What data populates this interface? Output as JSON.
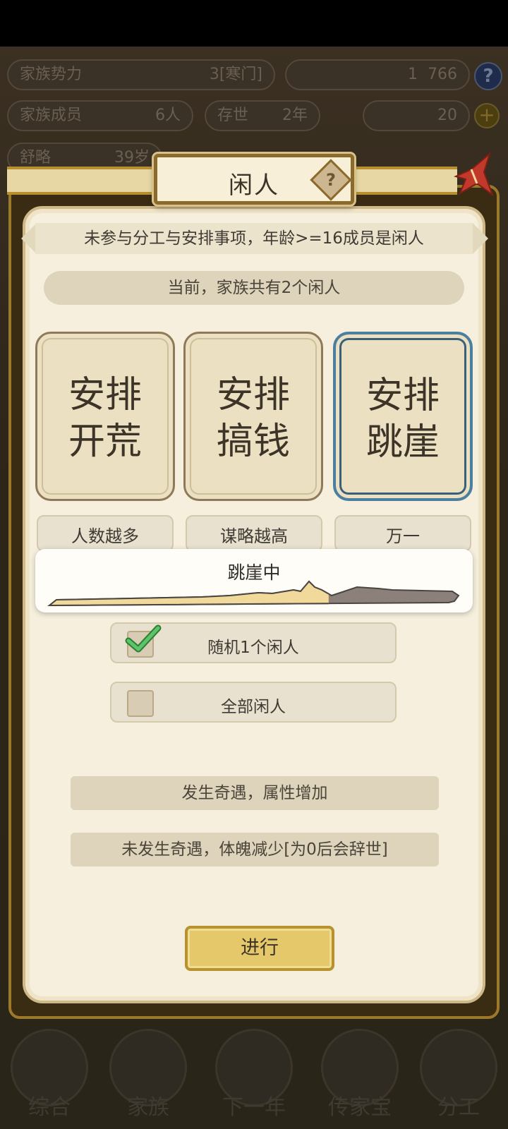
{
  "background": {
    "stats": {
      "power_label": "家族势力",
      "power_value": "3[寒门]",
      "currency_prefix": "1",
      "currency_value": "766",
      "members_label": "家族成员",
      "members_value": "6人",
      "survive_label": "存世",
      "survive_value": "2年",
      "gold_value": "20",
      "row3_label": "舒略",
      "row3_value": "39岁"
    },
    "nav": [
      "综合",
      "家族",
      "下一年",
      "传家宝",
      "分工"
    ]
  },
  "modal": {
    "title": "闲人",
    "help_glyph": "?",
    "info_banner": "未参与分工与安排事项，年龄>=16成员是闲人",
    "idle_count_text": "当前，家族共有2个闲人",
    "options": [
      {
        "label": "安排\n开荒",
        "desc": "人数越多",
        "selected": false
      },
      {
        "label": "安排\n搞钱",
        "desc": "谋略越高",
        "selected": false
      },
      {
        "label": "安排\n跳崖",
        "desc": "万一",
        "selected": true
      }
    ],
    "progress": {
      "label": "跳崖中",
      "fraction": 0.68
    },
    "choices": [
      {
        "label": "随机1个闲人",
        "checked": true
      },
      {
        "label": "全部闲人",
        "checked": false
      }
    ],
    "outcomes": [
      "发生奇遇，属性增加",
      "未发生奇遇，体魄减少[为0后会辞世]"
    ],
    "go_button": "进行"
  },
  "colors": {
    "accent_blue": "#4b7fa0",
    "progress_fill": "#f0d99a",
    "progress_rest": "#8b817a",
    "check_green": "#4caf50",
    "close_red": "#c0392b"
  }
}
